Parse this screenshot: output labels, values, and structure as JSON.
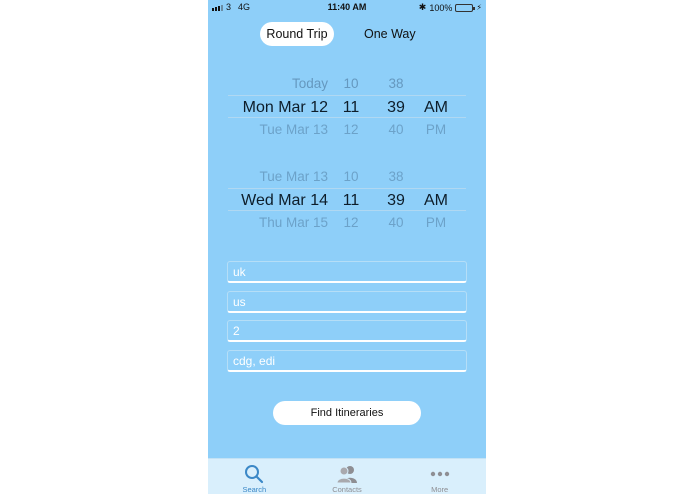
{
  "status_bar": {
    "carrier": "3",
    "network": "4G",
    "time": "11:40 AM",
    "battery": "100%",
    "battery_color": "#4cd964"
  },
  "trip_type": {
    "options": [
      "Round Trip",
      "One Way"
    ],
    "selected": "Round Trip"
  },
  "departure_picker": {
    "rows": [
      {
        "date": "Today",
        "hour": "10",
        "minute": "38",
        "ampm": ""
      },
      {
        "date": "Mon Mar 12",
        "hour": "11",
        "minute": "39",
        "ampm": "AM"
      },
      {
        "date": "Tue Mar 13",
        "hour": "12",
        "minute": "40",
        "ampm": "PM"
      }
    ]
  },
  "return_picker": {
    "rows": [
      {
        "date": "Tue Mar 13",
        "hour": "10",
        "minute": "38",
        "ampm": ""
      },
      {
        "date": "Wed Mar 14",
        "hour": "11",
        "minute": "39",
        "ampm": "AM"
      },
      {
        "date": "Thu Mar 15",
        "hour": "12",
        "minute": "40",
        "ampm": "PM"
      }
    ]
  },
  "fields": {
    "origin": "uk",
    "destination": "us",
    "passengers": "2",
    "airports": "cdg, edi"
  },
  "find_button": "Find Itineraries",
  "tabbar": {
    "items": [
      {
        "label": "Search",
        "icon": "search-icon",
        "active": true
      },
      {
        "label": "Contacts",
        "icon": "contacts-icon",
        "active": false
      },
      {
        "label": "More",
        "icon": "more-icon",
        "active": false
      }
    ],
    "active_color": "#3b88c7",
    "inactive_color": "#8e8e93"
  },
  "colors": {
    "background": "#8ecff9",
    "accent": "#ffffff"
  }
}
